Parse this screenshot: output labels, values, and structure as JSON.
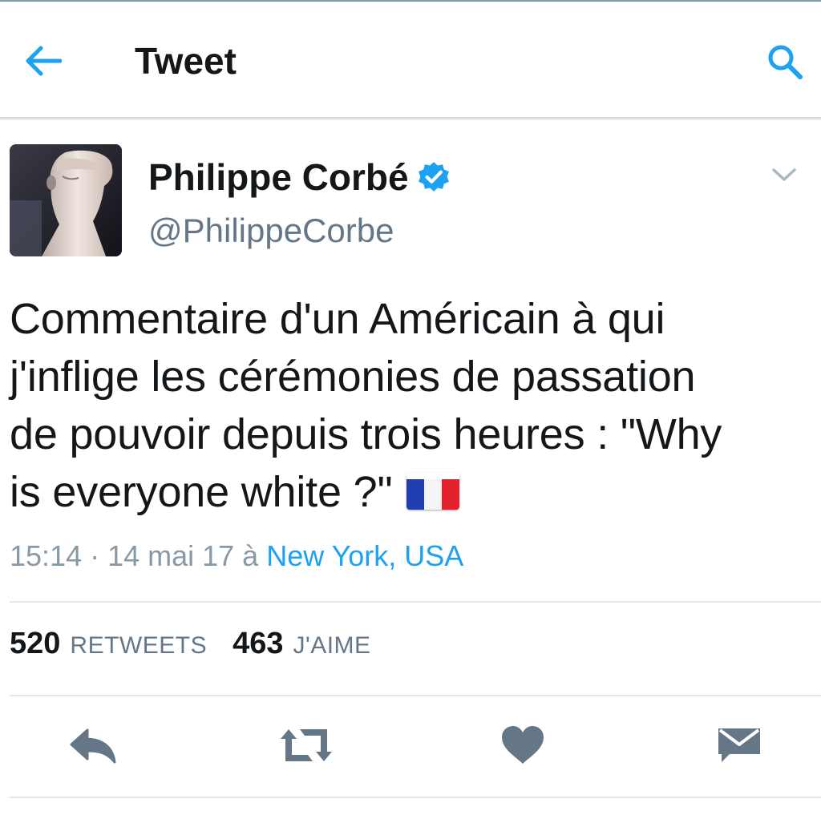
{
  "header": {
    "title": "Tweet",
    "back_icon": "arrow-left-icon",
    "search_icon": "search-icon"
  },
  "tweet": {
    "author": {
      "display_name": "Philippe Corbé",
      "handle": "@PhilippeCorbe",
      "verified": true
    },
    "text_lines": [
      "Commentaire d'un Américain à qui",
      "j'inflige les cérémonies de passation",
      "de pouvoir depuis trois heures : \"Why",
      "is everyone white ?\""
    ],
    "emoji": "french-flag",
    "timestamp": "15:14 · 14 mai 17 à ",
    "location": "New York, USA",
    "retweets_count": "520",
    "retweets_label": "RETWEETS",
    "likes_count": "463",
    "likes_label": "J'AIME"
  },
  "actions": [
    "reply-icon",
    "retweet-icon",
    "heart-icon",
    "direct-message-icon"
  ],
  "colors": {
    "accent": "#1da1f2",
    "text": "#14171a",
    "secondary": "#657786",
    "meta": "#8899a6",
    "icon_gray": "#657786",
    "divider": "#e1e8ed"
  }
}
